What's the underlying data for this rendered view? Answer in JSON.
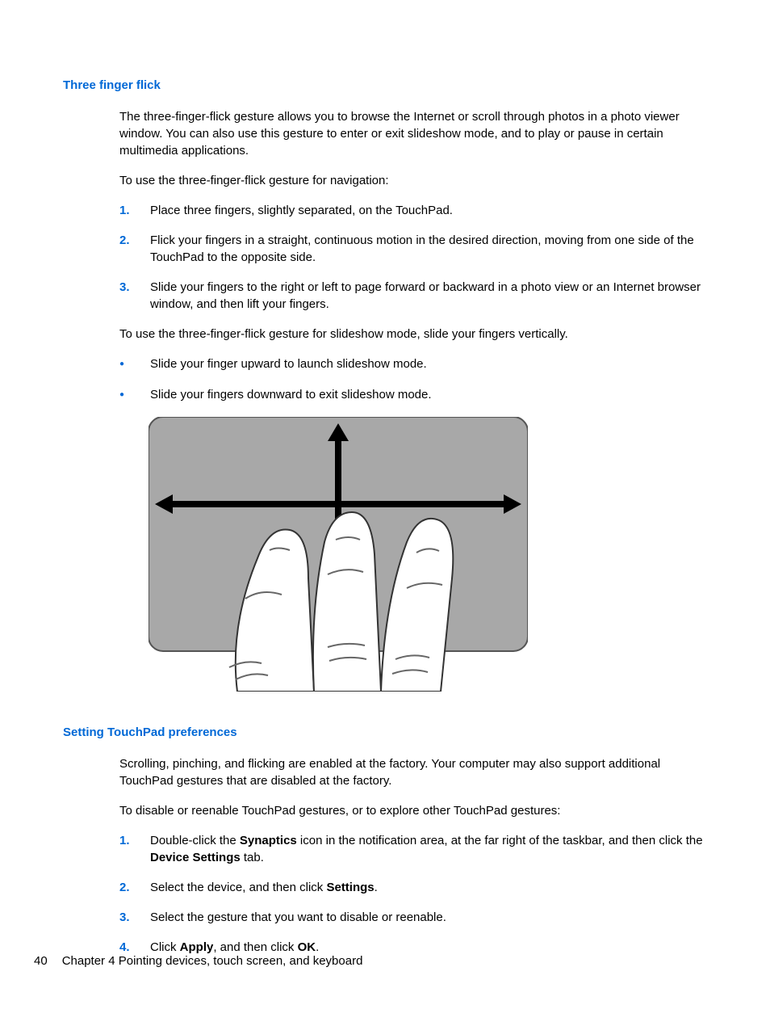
{
  "section1": {
    "title": "Three finger flick",
    "intro": "The three-finger-flick gesture allows you to browse the Internet or scroll through photos in a photo viewer window. You can also use this gesture to enter or exit slideshow mode, and to play or pause in certain multimedia applications.",
    "nav_lead": "To use the three-finger-flick gesture for navigation:",
    "steps": [
      "Place three fingers, slightly separated, on the TouchPad.",
      "Flick your fingers in a straight, continuous motion in the desired direction, moving from one side of the TouchPad to the opposite side.",
      "Slide your fingers to the right or left to page forward or backward in a photo view or an Internet browser window, and then lift your fingers."
    ],
    "slide_lead": "To use the three-finger-flick gesture for slideshow mode, slide your fingers vertically.",
    "bullets": [
      "Slide your finger upward to launch slideshow mode.",
      "Slide your fingers downward to exit slideshow mode."
    ]
  },
  "section2": {
    "title": "Setting TouchPad preferences",
    "intro": "Scrolling, pinching, and flicking are enabled at the factory. Your computer may also support additional TouchPad gestures that are disabled at the factory.",
    "lead": "To disable or reenable TouchPad gestures, or to explore other TouchPad gestures:",
    "step1_a": "Double-click the ",
    "step1_b": "Synaptics",
    "step1_c": " icon in the notification area, at the far right of the taskbar, and then click the ",
    "step1_d": "Device Settings",
    "step1_e": " tab.",
    "step2_a": "Select the device, and then click ",
    "step2_b": "Settings",
    "step2_c": ".",
    "step3": "Select the gesture that you want to disable or reenable.",
    "step4_a": "Click ",
    "step4_b": "Apply",
    "step4_c": ", and then click ",
    "step4_d": "OK",
    "step4_e": "."
  },
  "footer": {
    "page": "40",
    "chapter": "Chapter 4   Pointing devices, touch screen, and keyboard"
  },
  "nums": {
    "n1": "1.",
    "n2": "2.",
    "n3": "3.",
    "n4": "4."
  },
  "bullet_glyph": "●"
}
